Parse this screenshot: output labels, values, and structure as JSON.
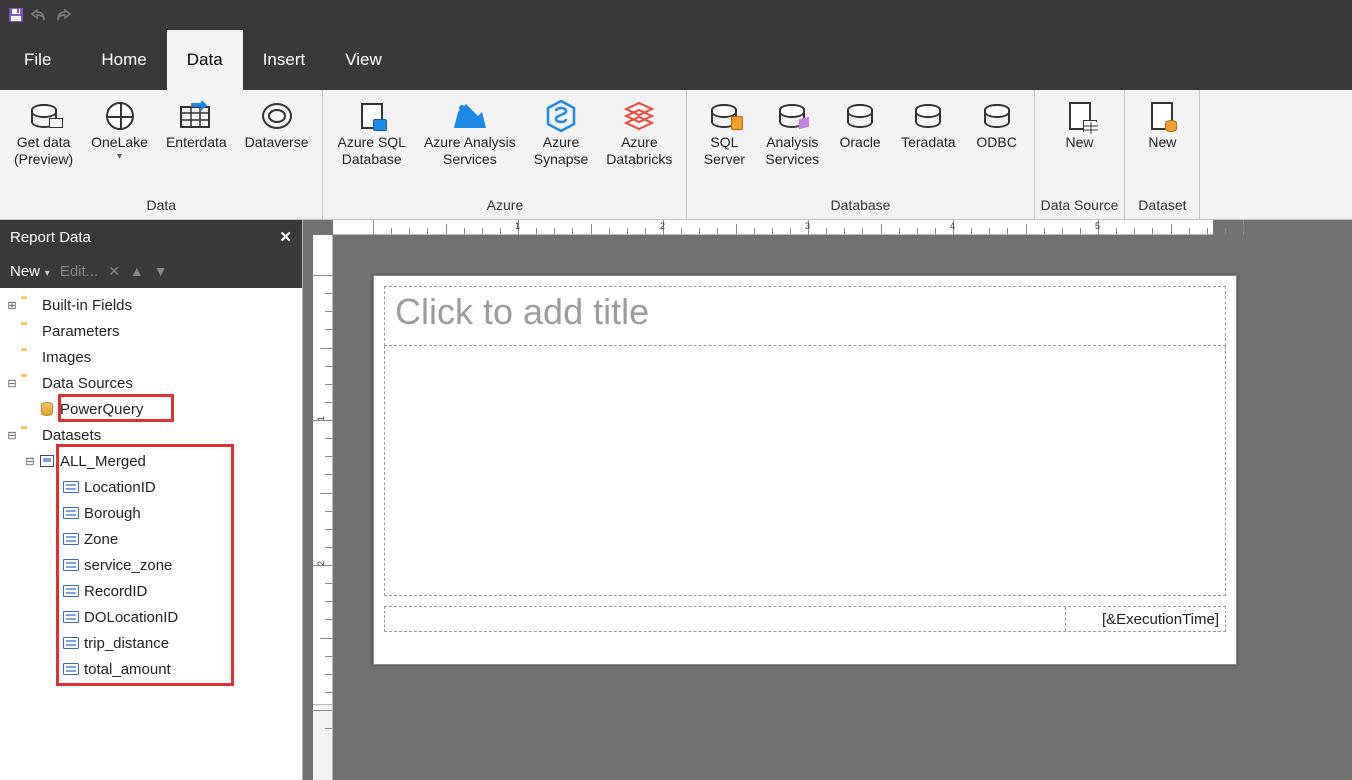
{
  "titlebar": {},
  "tabs": {
    "items": [
      "File",
      "Home",
      "Data",
      "Insert",
      "View"
    ],
    "active": "Data"
  },
  "ribbon": {
    "groups": [
      {
        "label": "Data",
        "buttons": [
          {
            "label": "Get data\n(Preview)",
            "icon": "cyl-grid",
            "name": "get-data-button"
          },
          {
            "label": "OneLake",
            "icon": "globe",
            "name": "onelake-button",
            "caret": true
          },
          {
            "label": "Enterdata",
            "icon": "table-arrow",
            "name": "enter-data-button"
          },
          {
            "label": "Dataverse",
            "icon": "dv",
            "name": "dataverse-button"
          }
        ]
      },
      {
        "label": "Azure",
        "buttons": [
          {
            "label": "Azure SQL\nDatabase",
            "icon": "sqlazure",
            "name": "azure-sql-db-button"
          },
          {
            "label": "Azure Analysis\nServices",
            "icon": "aas",
            "name": "azure-analysis-services-button"
          },
          {
            "label": "Azure\nSynapse",
            "icon": "synapse",
            "name": "azure-synapse-button"
          },
          {
            "label": "Azure\nDatabricks",
            "icon": "databricks",
            "name": "azure-databricks-button"
          }
        ]
      },
      {
        "label": "Database",
        "buttons": [
          {
            "label": "SQL\nServer",
            "icon": "cyl-orange",
            "name": "sql-server-button"
          },
          {
            "label": "Analysis\nServices",
            "icon": "cyl-cube",
            "name": "analysis-services-button"
          },
          {
            "label": "Oracle",
            "icon": "cyl",
            "name": "oracle-button"
          },
          {
            "label": "Teradata",
            "icon": "cyl",
            "name": "teradata-button"
          },
          {
            "label": "ODBC",
            "icon": "cyl",
            "name": "odbc-button"
          }
        ]
      },
      {
        "label": "Data Source",
        "buttons": [
          {
            "label": "New",
            "icon": "doc-grid",
            "name": "new-data-source-button"
          }
        ]
      },
      {
        "label": "Dataset",
        "buttons": [
          {
            "label": "New",
            "icon": "doc-cyl",
            "name": "new-dataset-button"
          }
        ]
      }
    ]
  },
  "panel": {
    "title": "Report Data",
    "toolbar": {
      "new_label": "New",
      "edit_label": "Edit..."
    },
    "tree": {
      "builtin": "Built-in Fields",
      "parameters": "Parameters",
      "images": "Images",
      "datasources": {
        "label": "Data Sources",
        "items": [
          {
            "name": "PowerQuery"
          }
        ]
      },
      "datasets": {
        "label": "Datasets",
        "items": [
          {
            "name": "ALL_Merged",
            "fields": [
              "LocationID",
              "Borough",
              "Zone",
              "service_zone",
              "RecordID",
              "DOLocationID",
              "trip_distance",
              "total_amount"
            ]
          }
        ]
      }
    }
  },
  "report": {
    "title_placeholder": "Click to add title",
    "footer_expr": "[&ExecutionTime]",
    "ruler_marks": [
      "1",
      "2",
      "3",
      "4",
      "5"
    ]
  }
}
